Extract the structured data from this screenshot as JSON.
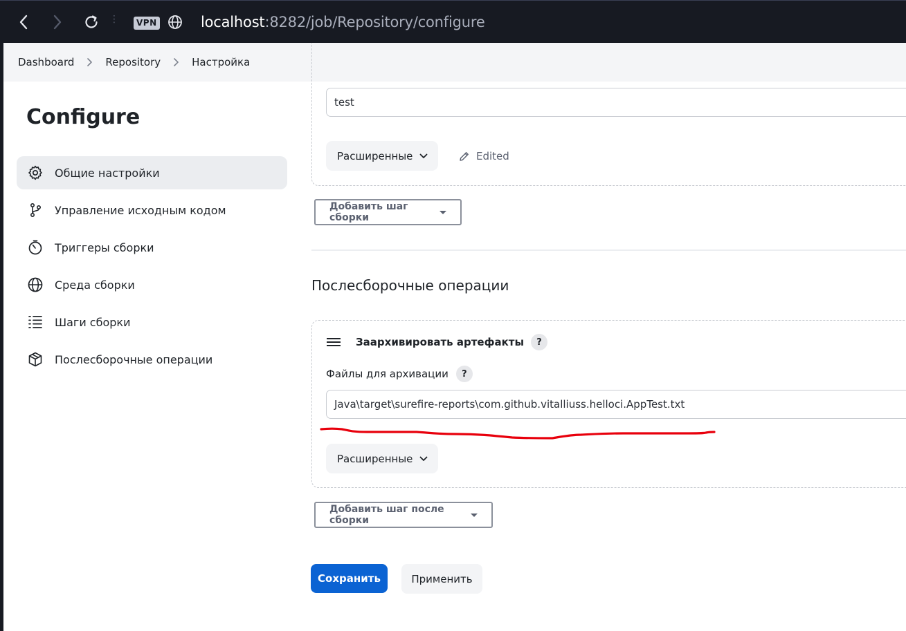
{
  "browser": {
    "vpn_label": "VPN",
    "url_host": "localhost",
    "url_rest": ":8282/job/Repository/configure"
  },
  "breadcrumb": {
    "items": [
      "Dashboard",
      "Repository",
      "Настройка"
    ]
  },
  "sidebar": {
    "title": "Configure",
    "items": [
      {
        "label": "Общие настройки",
        "icon": "gear-icon",
        "active": true
      },
      {
        "label": "Управление исходным кодом",
        "icon": "branch-icon"
      },
      {
        "label": "Триггеры сборки",
        "icon": "timer-icon"
      },
      {
        "label": "Среда сборки",
        "icon": "globe-icon"
      },
      {
        "label": "Шаги сборки",
        "icon": "list-icon"
      },
      {
        "label": "Послесборочные операции",
        "icon": "package-icon"
      }
    ]
  },
  "build_step": {
    "command_value": "test",
    "advanced_label": "Расширенные",
    "edited_label": "Edited",
    "add_step_label": "Добавить шаг сборки"
  },
  "post_build": {
    "section_title": "Послесборочные операции",
    "card_title": "Заархивировать артефакты",
    "help_label": "?",
    "files_label": "Файлы для архивации",
    "files_value": "Java\\target\\surefire-reports\\com.github.vitalliuss.helloci.AppTest.txt",
    "advanced_label": "Расширенные",
    "add_step_label": "Добавить шаг после сборки"
  },
  "actions": {
    "save_label": "Сохранить",
    "apply_label": "Применить"
  },
  "colors": {
    "primary": "#0b63d3",
    "annotation": "#e8000c",
    "chrome": "#171a22"
  }
}
